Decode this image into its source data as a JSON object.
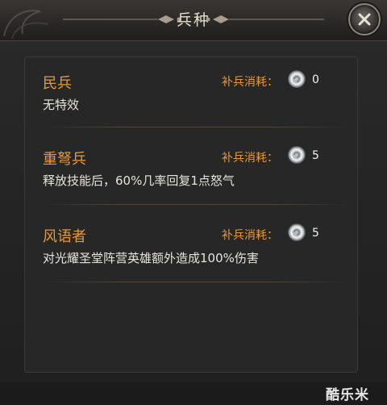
{
  "window": {
    "title": "兵种"
  },
  "units": [
    {
      "name": "民兵",
      "description": "无特效",
      "cost_label": "补兵消耗：",
      "cost_value": "0"
    },
    {
      "name": "重弩兵",
      "description": "释放技能后，60%几率回复1点怒气",
      "cost_label": "补兵消耗：",
      "cost_value": "5"
    },
    {
      "name": "风语者",
      "description": "对光耀圣堂阵营英雄额外造成100%伤害",
      "cost_label": "补兵消耗：",
      "cost_value": "5"
    }
  ],
  "watermark": "酷乐米",
  "icons": {
    "close": "close-icon",
    "cost": "silver-coin-icon"
  },
  "colors": {
    "unit_name": "#e49a3c",
    "cost_label": "#e49a3c",
    "description": "#e9e4da",
    "title": "#e7dfcf"
  }
}
